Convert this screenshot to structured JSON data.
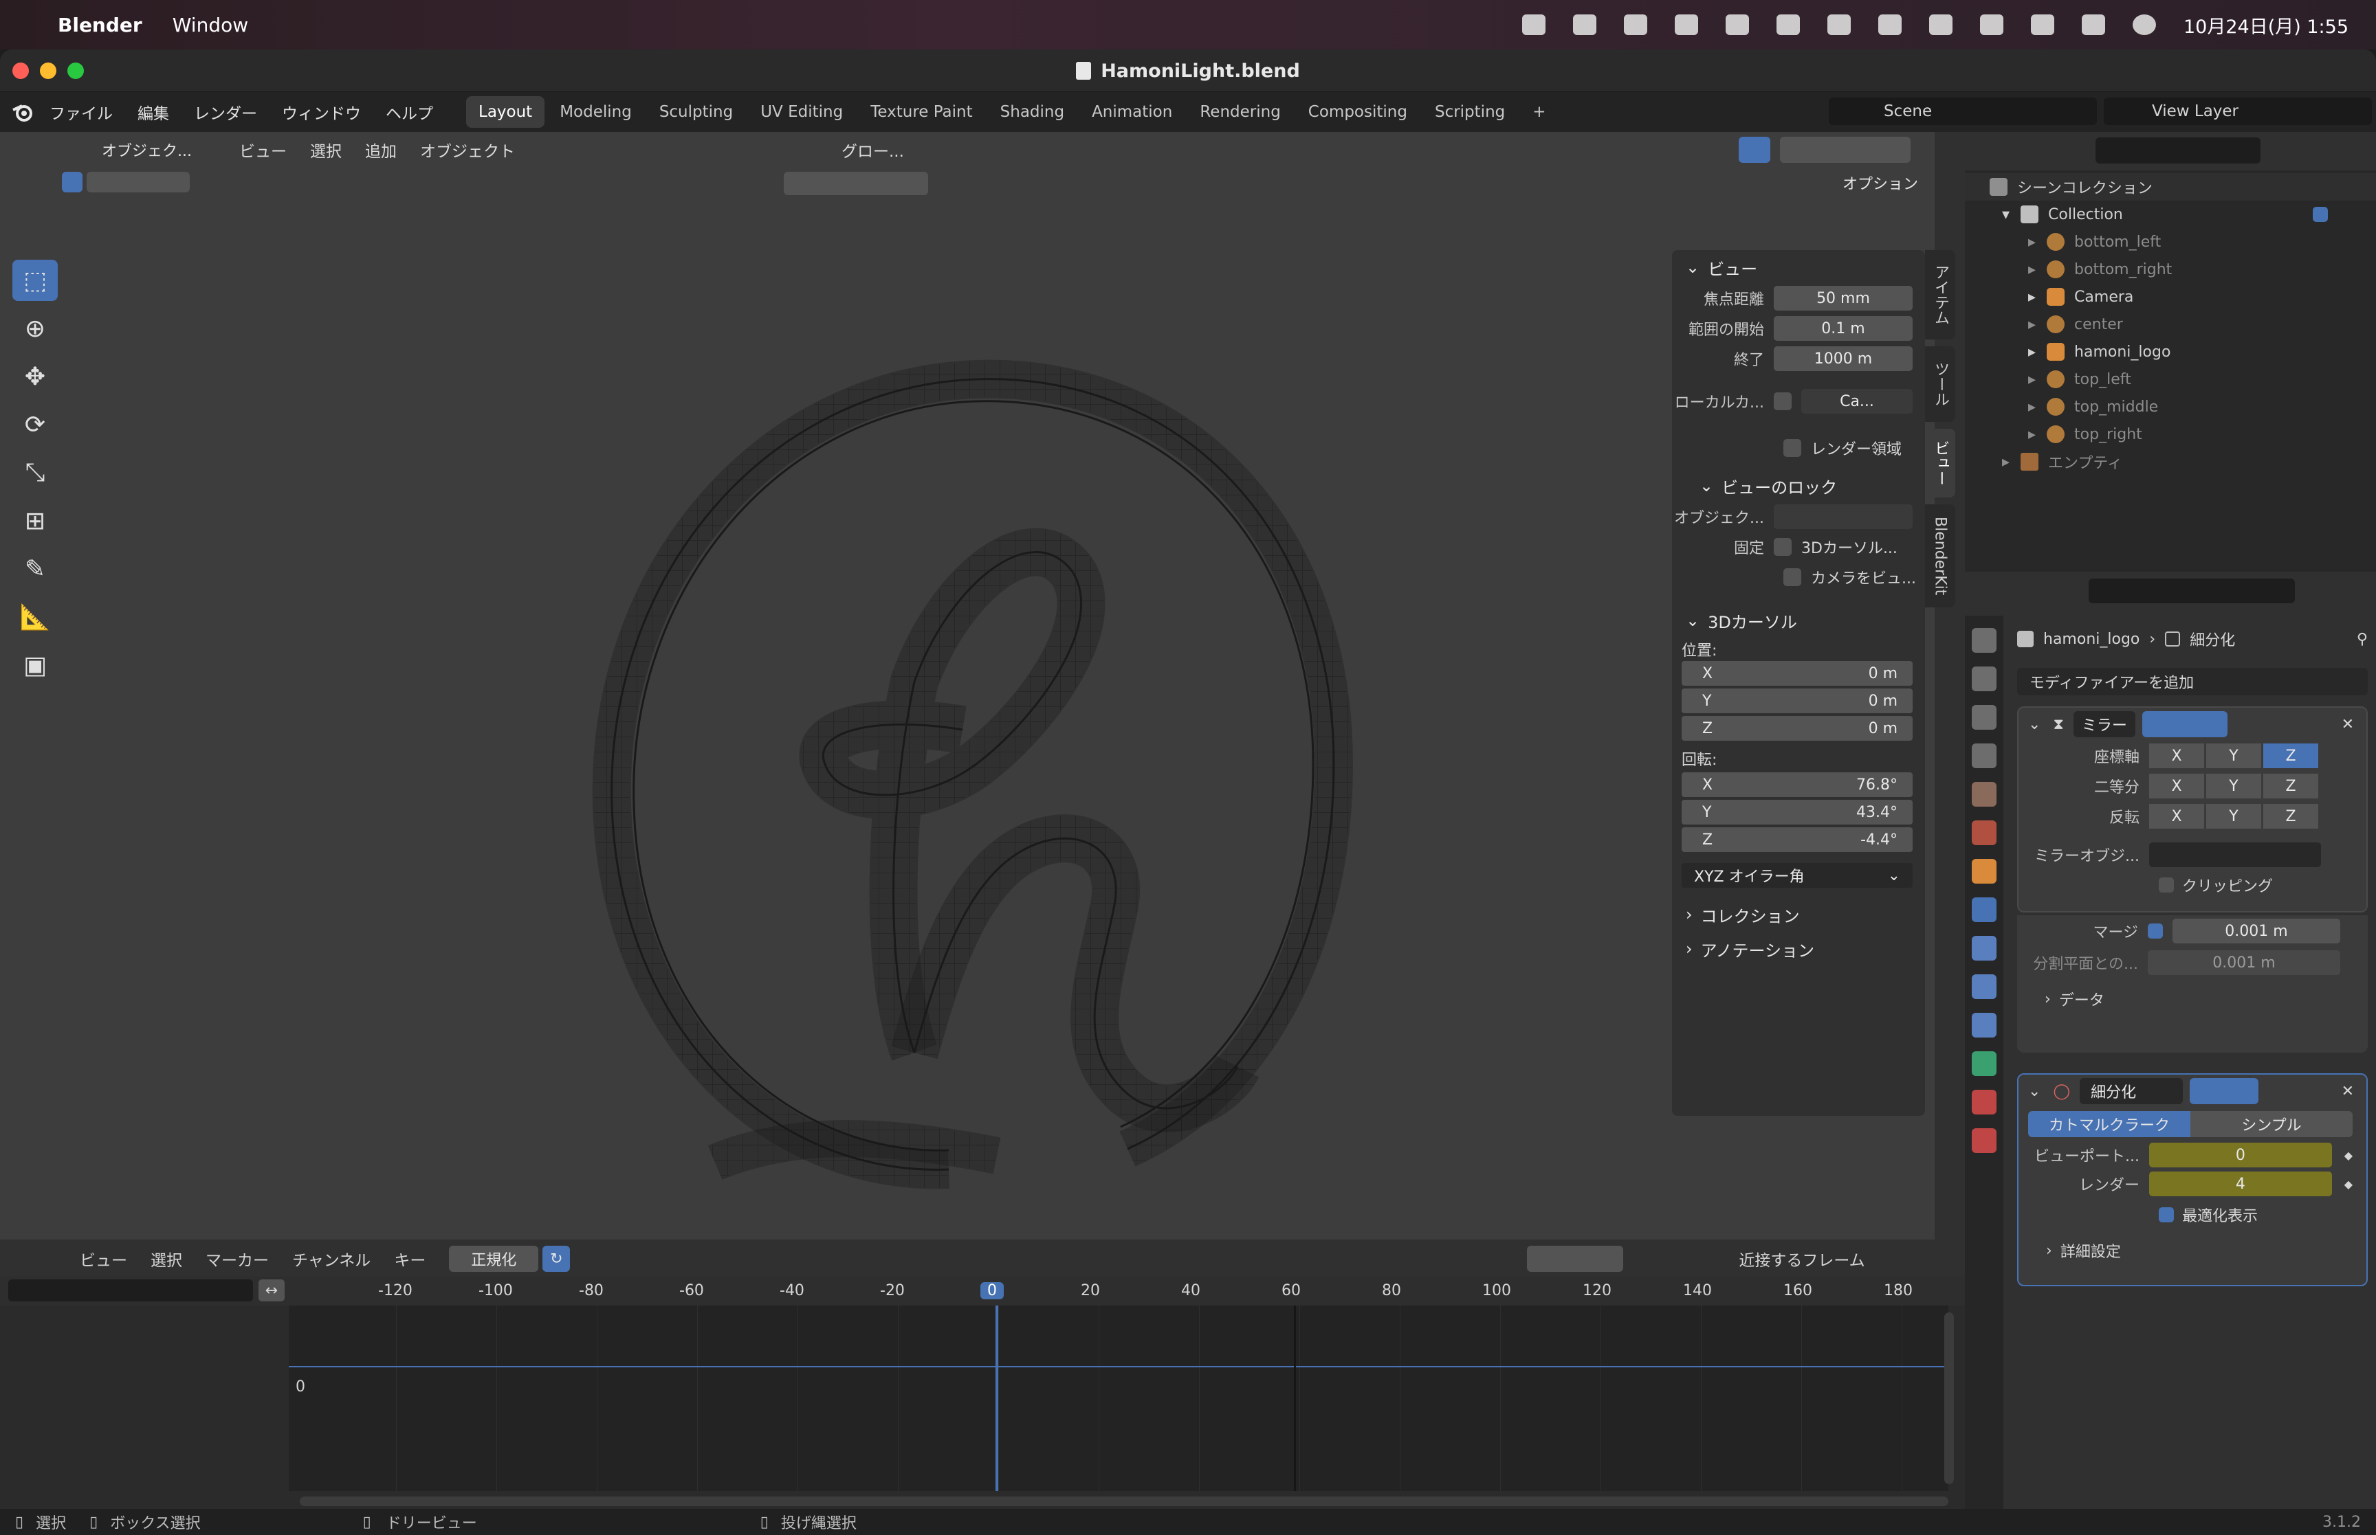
{
  "macbar": {
    "app_name": "Blender",
    "menu_window": "Window",
    "datetime": "10月24日(月) 1:55"
  },
  "window": {
    "title": "HamoniLight.blend"
  },
  "topbar": {
    "menus": [
      "ファイル",
      "編集",
      "レンダー",
      "ウィンドウ",
      "ヘルプ"
    ],
    "workspaces": [
      "Layout",
      "Modeling",
      "Sculpting",
      "UV Editing",
      "Texture Paint",
      "Shading",
      "Animation",
      "Rendering",
      "Compositing",
      "Scripting"
    ],
    "add_tab": "+",
    "scene": "Scene",
    "view_layer": "View Layer"
  },
  "viewport": {
    "mode": "オブジェク...",
    "menus": [
      "ビュー",
      "選択",
      "追加",
      "オブジェクト"
    ],
    "transform": "グロー...",
    "options": "オプション"
  },
  "npanel": {
    "view_header": "ビュー",
    "focal_label": "焦点距離",
    "focal_value": "50 mm",
    "clip_start_label": "範囲の開始",
    "clip_start_value": "0.1 m",
    "clip_end_label": "終了",
    "clip_end_value": "1000 m",
    "local_camera_label": "ローカルカ...",
    "local_camera_value": "Ca...",
    "render_region": "レンダー領域",
    "view_lock_header": "ビューのロック",
    "object_label": "オブジェク...",
    "lock_label": "固定",
    "lock_cursor": "3Dカーソル...",
    "lock_camera": "カメラをビュ...",
    "cursor_header": "3Dカーソル",
    "location_label": "位置:",
    "loc_x": "0 m",
    "loc_y": "0 m",
    "loc_z": "0 m",
    "rotation_label": "回転:",
    "rot_x": "76.8°",
    "rot_y": "43.4°",
    "rot_z": "-4.4°",
    "axis_x": "X",
    "axis_y": "Y",
    "axis_z": "Z",
    "rotation_mode": "XYZ オイラー角",
    "collection_header": "コレクション",
    "annotation_header": "アノテーション",
    "tabs": [
      "アイテム",
      "ツール",
      "ビュー",
      "BlenderKit"
    ]
  },
  "outliner": {
    "scene_collection": "シーンコレクション",
    "collection": "Collection",
    "items": [
      "bottom_left",
      "bottom_right",
      "Camera",
      "center",
      "hamoni_logo",
      "top_left",
      "top_middle",
      "top_right"
    ],
    "empty": "エンプティ"
  },
  "properties": {
    "object_name": "hamoni_logo",
    "modifier_name": "細分化",
    "add_modifier": "モディファイアーを追加",
    "mirror": {
      "name": "ミラー",
      "axis_label": "座標軸",
      "bisect_label": "二等分",
      "flip_label": "反転",
      "axes": [
        "X",
        "Y",
        "Z"
      ],
      "mirror_object_label": "ミラーオブジ...",
      "clipping": "クリッピング",
      "merge_label": "マージ",
      "merge_value": "0.001 m",
      "bisect_distance_label": "分割平面との...",
      "bisect_distance_value": "0.001 m",
      "data": "データ"
    },
    "subsurf": {
      "name": "細分化",
      "catmull": "カトマルクラーク",
      "simple": "シンプル",
      "viewport_label": "ビューポート...",
      "viewport_value": "0",
      "render_label": "レンダー",
      "render_value": "4",
      "optimal": "最適化表示",
      "advanced": "詳細設定"
    }
  },
  "timeline": {
    "menus": [
      "ビュー",
      "選択",
      "マーカー",
      "チャンネル",
      "キー"
    ],
    "normalize": "正規化",
    "nearest_frame": "近接するフレーム",
    "ticks": [
      "-120",
      "-100",
      "-80",
      "-60",
      "-40",
      "-20",
      "0",
      "20",
      "40",
      "60",
      "80",
      "100",
      "120",
      "140",
      "160",
      "180"
    ],
    "current_frame": "0",
    "channel_value": "0"
  },
  "statusbar": {
    "select": "選択",
    "box_select": "ボックス選択",
    "dolly": "ドリービュー",
    "lasso": "投げ縄選択",
    "version": "3.1.2"
  },
  "colors": {
    "accent": "#4772b3",
    "yellow_field": "#7a7520",
    "orange": "#d98a3a"
  }
}
